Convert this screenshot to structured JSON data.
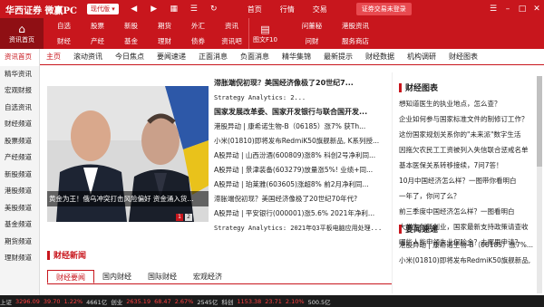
{
  "app": {
    "logo": "华西证券 微赢PC",
    "version": "现代版 ▾",
    "login": "证券交易未登录"
  },
  "top_nav": [
    "首页",
    "行情",
    "交易"
  ],
  "toolbar": {
    "home": "资讯首页",
    "grid": [
      "自选",
      "股票",
      "新股",
      "期货",
      "外汇",
      "资讯",
      "财经",
      "产经",
      "基金",
      "理财",
      "债券",
      "资讯吧"
    ],
    "big": "图文F10",
    "grid2": [
      "问董秘",
      "港股资讯",
      "问财",
      "服务商店"
    ]
  },
  "sidebar": [
    "资讯首页",
    "精华资讯",
    "宏观财报",
    "自选资讯",
    "财经频道",
    "股票频道",
    "产经频道",
    "新股频道",
    "港股频道",
    "美股频道",
    "基金频道",
    "期货频道",
    "理财频道"
  ],
  "tabs": [
    "主页",
    "滚动资讯",
    "今日焦点",
    "要闻速递",
    "正面消息",
    "负面消息",
    "精华集锦",
    "最新提示",
    "财经数据",
    "机构调研",
    "财经图表"
  ],
  "carousel": {
    "caption": "黄金为王！俄乌冲突打击风险偏好 资金涌入货...",
    "pages": [
      "1",
      "2"
    ]
  },
  "news": [
    "滞胀端倪初现？美国经济像极了20世纪7...",
    "Strategy Analytics: 2...",
    "国家发展改革委、国家开发银行与联合国开发...",
    "港股异动 | 康希诺生物-B（06185）涨7% 获Th...",
    "小米(01810)即将发布RedmiK50旗舰新品, K系列授...",
    "A股异动 | 山西汾酒(600809)涨8% 科创2号净利同...",
    "A股异动 | 景津装备(603279)放量涨5%! 业绩+同...",
    "A股异动 | 珀莱雅(603605)涨超8% 前2月净利同...",
    "滞胀端倪初现？美国经济像极了20世纪70年代?",
    "A股异动 | 平安银行(000001)涨5.6% 2021年净利...",
    "Strategy Analytics: 2021年Q3平板电脑应用处理..."
  ],
  "right_panel": {
    "title": "财经图表",
    "items": [
      "想知道医生的执业地点，怎么查？",
      "企业如何参与国家标准文件的制修订工作？",
      "这份国家规划关系你的\"未来派\"数字生活",
      "因拖欠农民工工资被列入失信联合惩戒名单",
      "基本医保关系转移接续，7问7答！",
      "10月中国经济怎么样？一图带你看明白",
      "一年了，你问了么？",
      "前三季度中国经济怎么样？一图看明白",
      "大学生创新创业，国家最新支持政策请查收",
      "哪些人能申领失业保险金？去哪里申请？"
    ],
    "title2": "要闻速递",
    "items2": [
      "港股异动 | 康希诺生物-B（06185）涨7%...",
      "小米(01810)即将发布RedmiK50旗舰新品,"
    ]
  },
  "finance_news": {
    "title": "财经新闻",
    "tabs": [
      "财经要闻",
      "国内财经",
      "国际财经",
      "宏观经济"
    ]
  },
  "statusbar": [
    "上证",
    "3296.09",
    "39.70",
    "1.22%",
    "4661亿",
    "创业",
    "2635.19",
    "68.47",
    "2.67%",
    "2545亿",
    "科创",
    "1153.38",
    "23.71",
    "2.10%",
    "500.5亿"
  ]
}
